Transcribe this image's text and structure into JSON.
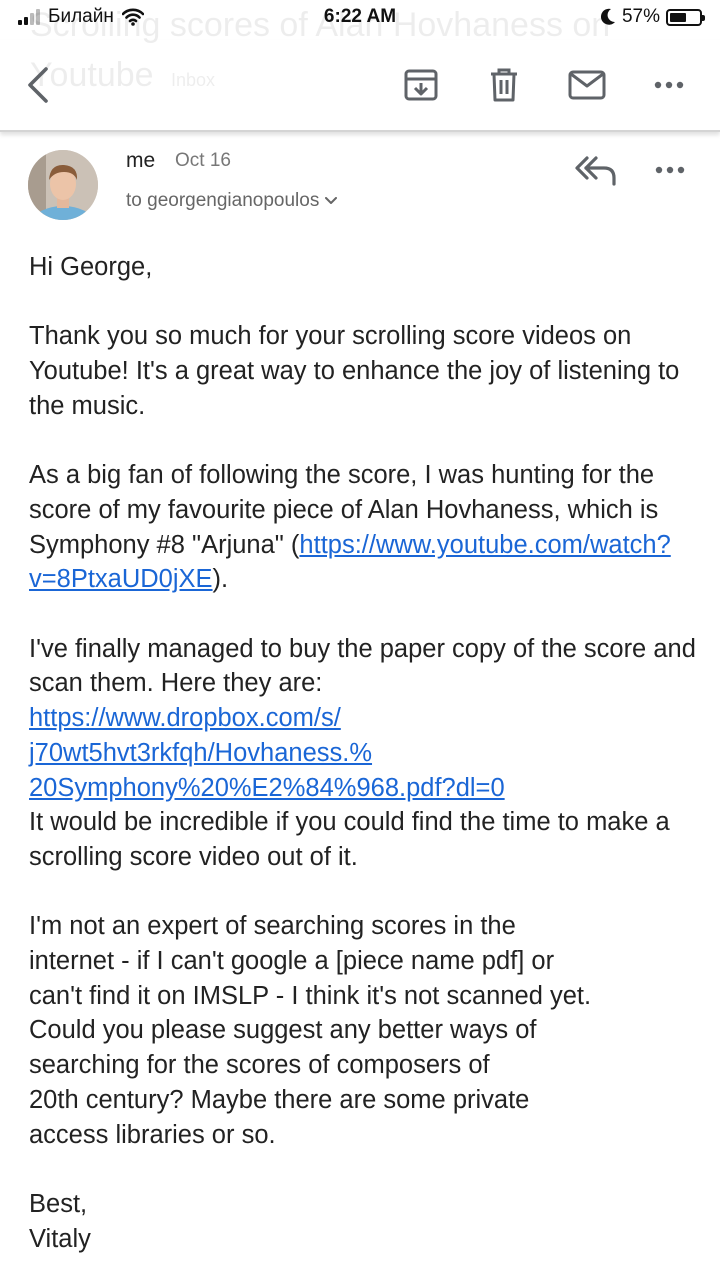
{
  "status_bar": {
    "carrier": "Билайн",
    "time": "6:22 AM",
    "battery": "57%",
    "battery_level": 0.57
  },
  "ghost_subject": "Scrolling scores of Alan Hovhaness on Youtube",
  "ghost_label": "Inbox",
  "toolbar": {
    "back": "chevron-left-icon",
    "archive": "archive-icon",
    "delete": "trash-icon",
    "mark_unread": "mail-icon",
    "more": "more-horizontal-icon"
  },
  "message": {
    "sender": "me",
    "date": "Oct 16",
    "recipient": "to georgengianopoulos",
    "greeting": "Hi George,",
    "p1": "Thank you so much for your scrolling score videos on Youtube! It's a great way to enhance the joy of listening to the music.",
    "p2_text": "As a big fan of following the score, I was hunting for the score of my favourite piece of Alan Hovhaness, which is Symphony #8 \"Arjuna\"",
    "p2_open": "(",
    "p2_link": "https://www.youtube.com/watch?v=8PtxaUD0jXE",
    "p2_close": ").",
    "p3_text": "I've finally managed to buy the paper copy of the score and scan them. Here they are:",
    "p3_link_l1": "https://www.dropbox.com/s/",
    "p3_link_l2": "j70wt5hvt3rkfqh/Hovhaness.%",
    "p3_link_l3": "20Symphony%20%E2%84%968.pdf?dl=0",
    "p3_after": "It would be incredible if you could find the time to make a scrolling score video out of it.",
    "p4_l1": "I'm not an expert of searching scores in the",
    "p4_l2": "internet - if I can't google a [piece name pdf] or",
    "p4_l3": "can't find it on IMSLP - I think it's not scanned yet.",
    "p4_l4": "Could you please suggest any better ways of",
    "p4_l5": "searching for the scores of composers of",
    "p4_l6": "20th century? Maybe there are some private",
    "p4_l7": "access libraries or so.",
    "closing": "Best,",
    "signature": "Vitaly"
  },
  "colors": {
    "link": "#1a66d6",
    "icon": "#5f6368"
  }
}
